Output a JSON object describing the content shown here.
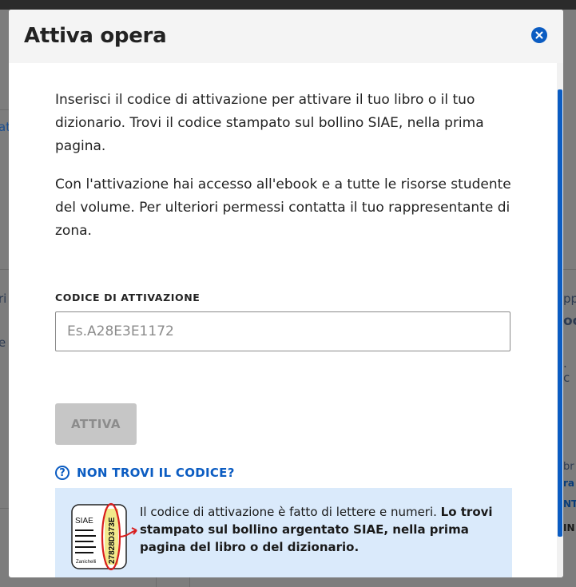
{
  "modal": {
    "title": "Attiva opera",
    "close_icon": "close-icon",
    "intro_paragraph_1": "Inserisci il codice di attivazione per attivare il tuo libro o il tuo dizionario. Trovi il codice stampato sul bollino SIAE, nella prima pagina.",
    "intro_paragraph_2": "Con l'attivazione hai accesso all'ebook e a tutte le risorse studente del volume. Per ulteriori permessi contatta il tuo rappresentante di zona.",
    "field": {
      "label": "CODICE DI ATTIVAZIONE",
      "value": "",
      "placeholder": "Es.A28E3E1172"
    },
    "activate_label": "ATTIVA",
    "help": {
      "icon": "question-circle-icon",
      "label": "NON TROVI IL CODICE?",
      "text_plain": "Il codice di attivazione è fatto di lettere e numeri. ",
      "text_bold": "Lo trovi stampato sul bollino argentato SIAE, nella prima pagina del libro o del dizionario.",
      "stamp": {
        "title": "SIAE",
        "code": "27828D373E",
        "publisher": "Zanichelli"
      }
    },
    "colors": {
      "accent": "#0b5cc2",
      "info_background": "#daeafb",
      "disabled_button": "#c6c6c6"
    }
  },
  "background": {
    "left_fragments": [
      "at",
      "ri",
      "e"
    ],
    "right_fragments": [
      "pp",
      "oc",
      ". c",
      "br",
      "ra",
      "NT",
      "IN"
    ]
  }
}
